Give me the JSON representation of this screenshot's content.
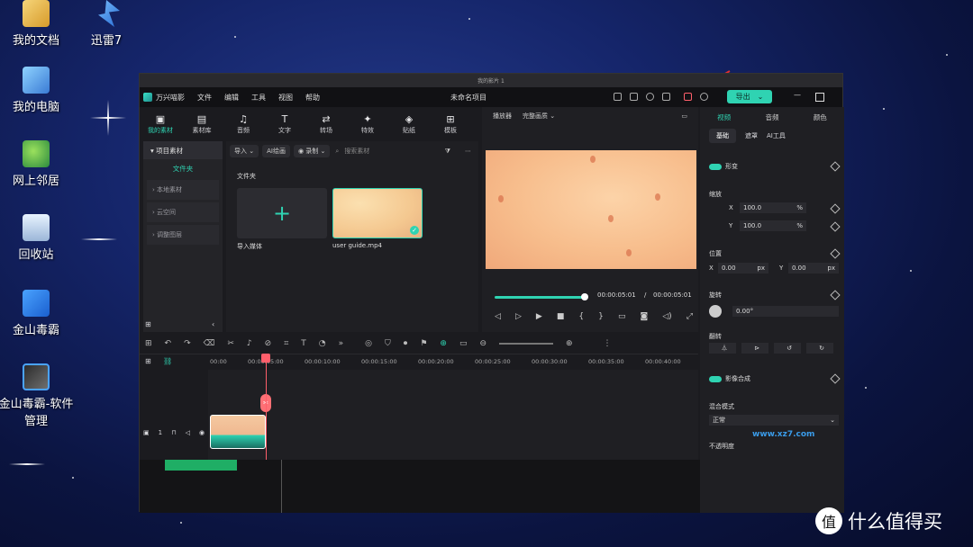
{
  "desktop": {
    "icons": [
      {
        "label": "我的文档",
        "icon": "documents-icon"
      },
      {
        "label": "迅雷7",
        "icon": "thunder-icon"
      },
      {
        "label": "我的电脑",
        "icon": "computer-icon"
      },
      {
        "label": "网上邻居",
        "icon": "network-icon"
      },
      {
        "label": "回收站",
        "icon": "recycle-bin-icon"
      },
      {
        "label": "金山毒霸",
        "icon": "antivirus-icon"
      },
      {
        "label": "金山毒霸-软件管理",
        "icon": "software-manager-icon"
      }
    ],
    "watermark": "什么值得买",
    "site_watermark": "www.xz7.com"
  },
  "window": {
    "outer_title": "我的影片 1",
    "app_name": "万兴喵影",
    "project_title": "未命名项目",
    "menu": [
      "文件",
      "编辑",
      "工具",
      "视图",
      "帮助"
    ],
    "export_label": "导出",
    "accent": "#2fd3b2"
  },
  "tools": [
    {
      "label": "我的素材",
      "glyph": "▣"
    },
    {
      "label": "素材库",
      "glyph": "▤"
    },
    {
      "label": "音频",
      "glyph": "♫"
    },
    {
      "label": "文字",
      "glyph": "T"
    },
    {
      "label": "转场",
      "glyph": "⇄"
    },
    {
      "label": "特效",
      "glyph": "✦"
    },
    {
      "label": "贴纸",
      "glyph": "◈"
    },
    {
      "label": "模板",
      "glyph": "⊞"
    }
  ],
  "sidebar": {
    "header": "项目素材",
    "active_folder": "文件夹",
    "items": [
      "本地素材",
      "云空间",
      "调整图层"
    ]
  },
  "media": {
    "import_label": "导入",
    "ai_label": "AI绘画",
    "record_label": "录制",
    "search_placeholder": "搜索素材",
    "folder_title": "文件夹",
    "import_media_label": "导入媒体",
    "clip_name": "user guide.mp4"
  },
  "player": {
    "tab": "播放器",
    "quality": "完整画质",
    "current_time": "00:00:05:01",
    "separator": "/",
    "total_time": "00:00:05:01"
  },
  "inspector": {
    "tabs": [
      "视频",
      "音频",
      "颜色"
    ],
    "subtabs": [
      "基础",
      "遮罩",
      "AI工具"
    ],
    "transform_label": "形变",
    "scale_label": "缩放",
    "scale_x_axis": "X",
    "scale_y_axis": "Y",
    "scale_x": "100.0",
    "scale_y": "100.0",
    "percent": "%",
    "position_label": "位置",
    "pos_x_axis": "X",
    "pos_y_axis": "Y",
    "pos_x": "0.00",
    "pos_y": "0.00",
    "px": "px",
    "rotation_label": "旋转",
    "rotation": "0.00°",
    "flip_label": "翻转",
    "composite_label": "影像合成",
    "blend_label": "混合模式",
    "blend_value": "正常",
    "opacity_label": "不透明度"
  },
  "timeline": {
    "ticks": [
      "00:00",
      "00:00:05:00",
      "00:00:10:00",
      "00:00:15:00",
      "00:00:20:00",
      "00:00:25:00",
      "00:00:30:00",
      "00:00:35:00",
      "00:00:40:00"
    ],
    "track_number": "1"
  }
}
